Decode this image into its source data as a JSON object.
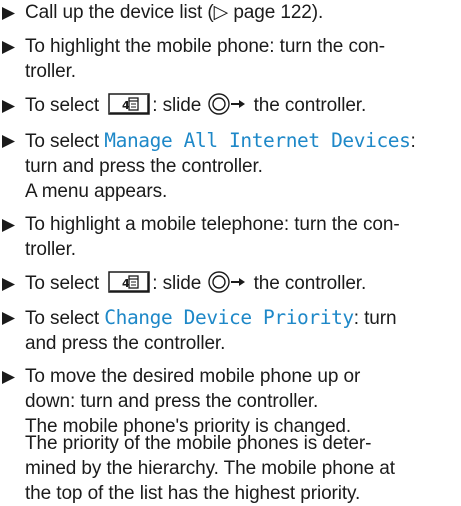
{
  "steps": [
    {
      "text": "Call up the device list (▷ page 122)."
    },
    {
      "line1": "To highlight the mobile phone: turn the con-",
      "line2": "troller."
    },
    {
      "before": "To select",
      "icon": "menu-key-icon",
      "after": ": slide",
      "slide_icon": "controller-slide-right-icon",
      "end": "the controller."
    },
    {
      "before": "To select",
      "menu_item": "Manage All Internet Devices",
      "after": ":",
      "line2": "turn and press the controller.",
      "line3": "A menu appears."
    },
    {
      "line1": "To highlight a mobile telephone: turn the con-",
      "line2": "troller."
    },
    {
      "before": "To select",
      "icon": "menu-key-icon",
      "after": ": slide",
      "slide_icon": "controller-slide-right-icon",
      "end": "the controller."
    },
    {
      "before": "To select",
      "menu_item": "Change Device Priority",
      "after": ": turn",
      "line2": "and press the controller."
    },
    {
      "line1": "To move the desired mobile phone up or",
      "line2": "down: turn and press the controller.",
      "line3": "The mobile phone's priority is changed."
    }
  ],
  "note": {
    "line1": "The priority of the mobile phones is deter-",
    "line2": "mined by the hierarchy. The mobile phone at",
    "line3": "the top of the list has the highest priority."
  },
  "colors": {
    "text": "#1b1b1b",
    "menu_item": "#1e88c8"
  }
}
